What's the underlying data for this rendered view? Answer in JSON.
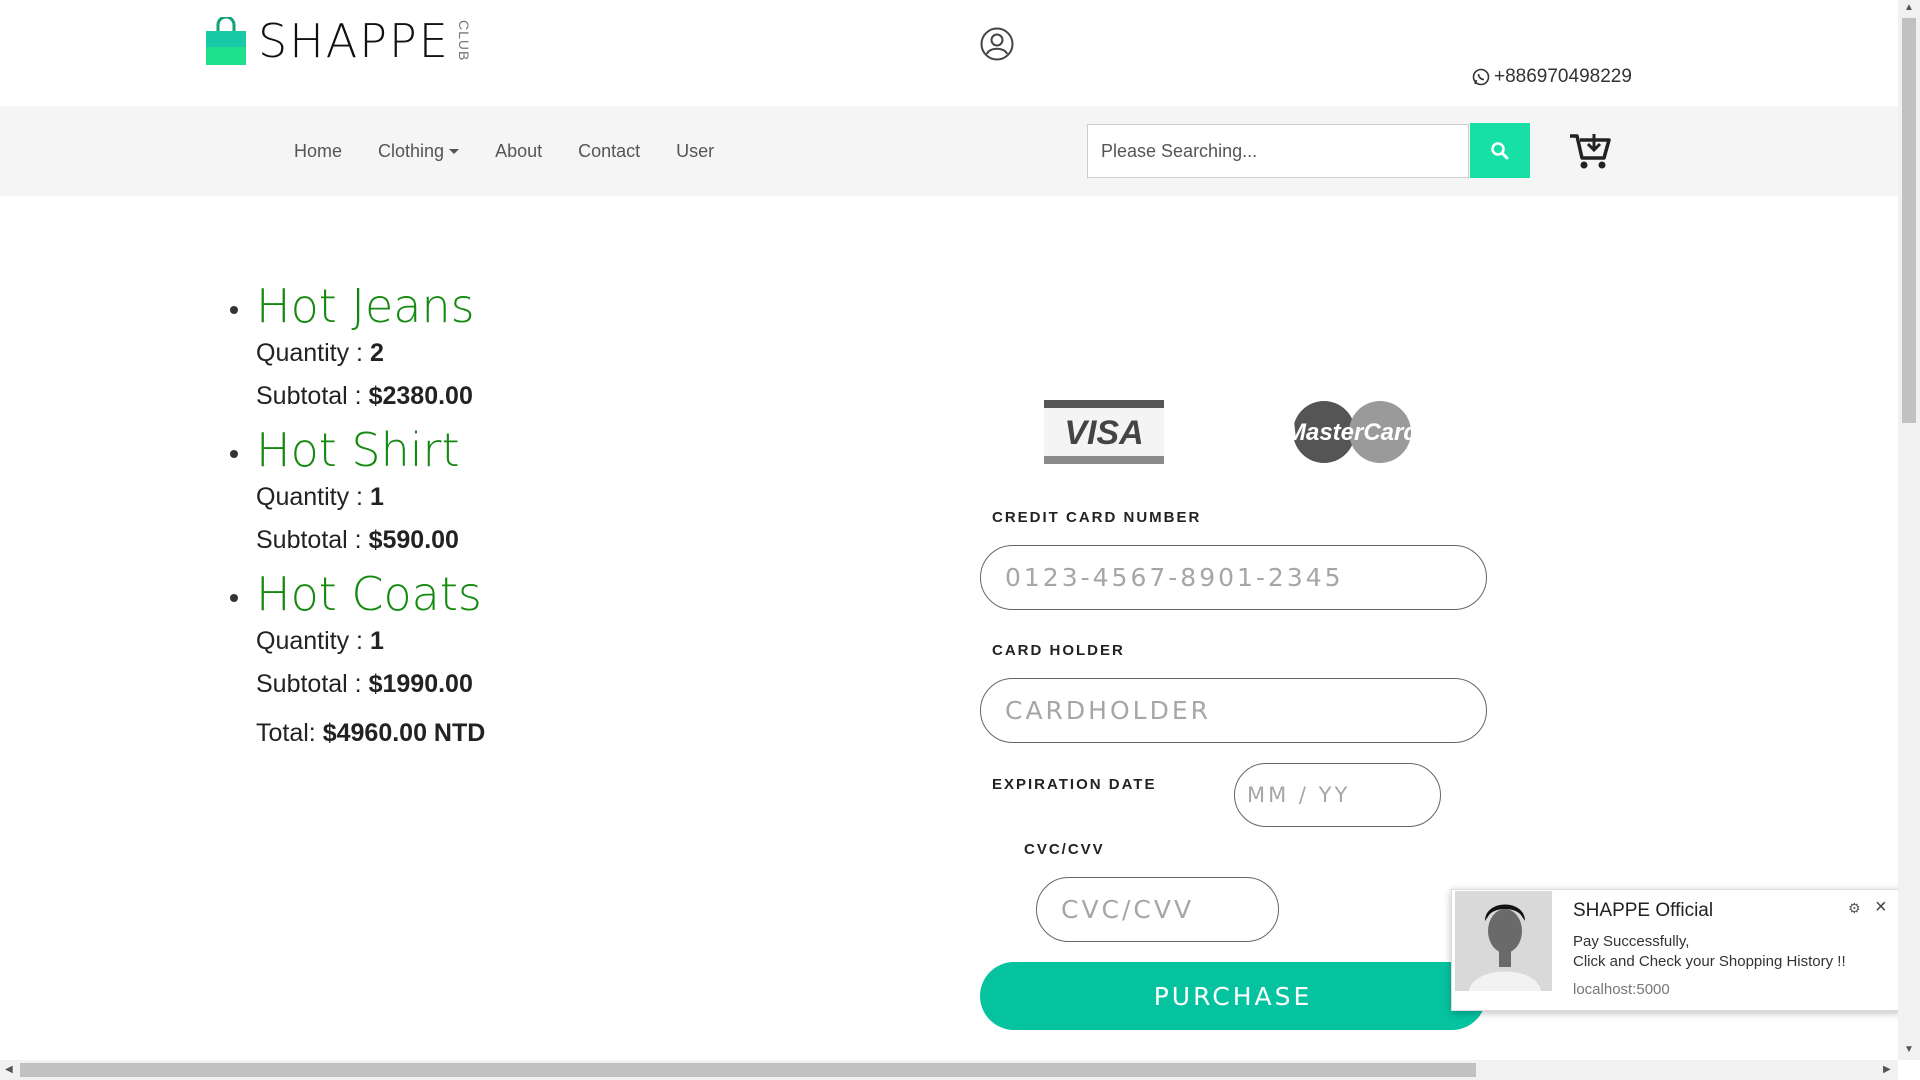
{
  "header": {
    "logo_text": "SHAPPE",
    "logo_sub": "CLUB",
    "phone": "+886970498229",
    "icons": {
      "logo": "shopping-bag-icon",
      "user": "user-circle-icon",
      "phone": "whatsapp-icon"
    }
  },
  "nav": {
    "links": [
      "Home",
      "Clothing",
      "About",
      "Contact",
      "User"
    ],
    "search_placeholder": "Please Searching...",
    "accent_color": "#17e0a6"
  },
  "order": {
    "quantity_label": "Quantity : ",
    "subtotal_label": "Subtotal : ",
    "items": [
      {
        "name": "Hot Jeans",
        "quantity": "2",
        "subtotal": "$2380.00"
      },
      {
        "name": "Hot Shirt",
        "quantity": "1",
        "subtotal": "$590.00"
      },
      {
        "name": "Hot Coats",
        "quantity": "1",
        "subtotal": "$1990.00"
      }
    ],
    "total_label": "Total: ",
    "total_value": "$4960.00 NTD",
    "item_color": "#138a0f"
  },
  "payment": {
    "card_logos": [
      "VISA",
      "MasterCard"
    ],
    "card_number_label": "CREDIT CARD NUMBER",
    "card_number_placeholder": "0123-4567-8901-2345",
    "holder_label": "CARD HOLDER",
    "holder_placeholder": "CARDHOLDER",
    "expiry_label": "EXPIRATION DATE",
    "expiry_placeholder": "MM / YY",
    "cvc_label": "CVC/CVV",
    "cvc_placeholder": "CVC/CVV",
    "purchase_label": "PURCHASE",
    "button_color": "#06c3a0"
  },
  "notification": {
    "title": "SHAPPE Official",
    "message_line1": "Pay Successfully,",
    "message_line2": "Click and Check your Shopping History !!",
    "origin": "localhost:5000"
  }
}
